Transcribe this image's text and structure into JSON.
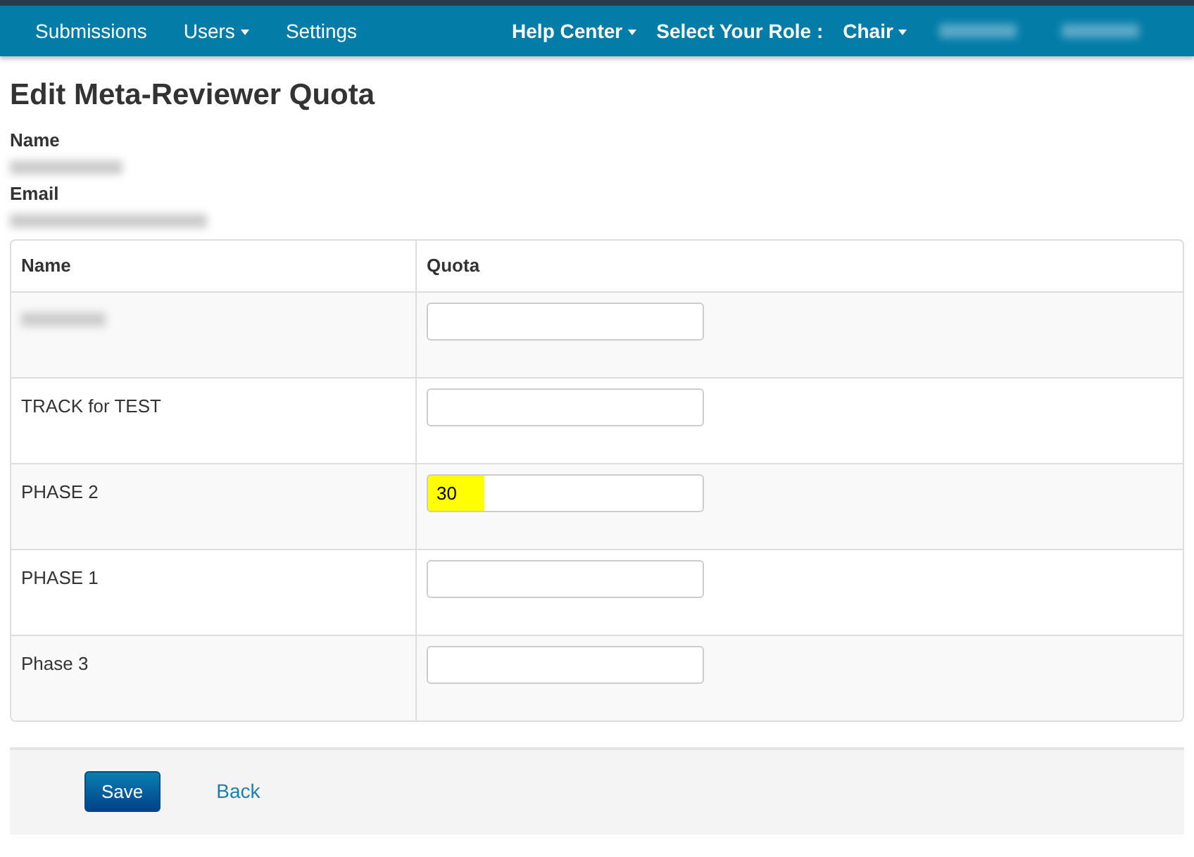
{
  "navbar": {
    "left_items": [
      {
        "label": "Submissions",
        "dropdown": false
      },
      {
        "label": "Users",
        "dropdown": true
      },
      {
        "label": "Settings",
        "dropdown": false
      }
    ],
    "help_center": {
      "label": "Help Center",
      "dropdown": true
    },
    "role_label": "Select Your Role :",
    "role": {
      "label": "Chair",
      "dropdown": true
    },
    "account_items": [
      {
        "redacted": true
      },
      {
        "redacted": true
      }
    ]
  },
  "title": "Edit Meta-Reviewer Quota",
  "fields": [
    {
      "label": "Name",
      "redacted": true
    },
    {
      "label": "Email",
      "redacted": true
    }
  ],
  "table": {
    "columns": [
      "Name",
      "Quota"
    ],
    "rows": [
      {
        "redacted": true,
        "quota": "",
        "highlighted": false
      },
      {
        "name": "TRACK for TEST",
        "redacted": false,
        "quota": "",
        "highlighted": false
      },
      {
        "name": "PHASE 2",
        "redacted": false,
        "quota": "30",
        "highlighted": true
      },
      {
        "name": "PHASE 1",
        "redacted": false,
        "quota": "",
        "highlighted": false
      },
      {
        "name": "Phase 3",
        "redacted": false,
        "quota": "",
        "highlighted": false
      }
    ]
  },
  "buttons": {
    "save": "Save",
    "back": "Back"
  }
}
